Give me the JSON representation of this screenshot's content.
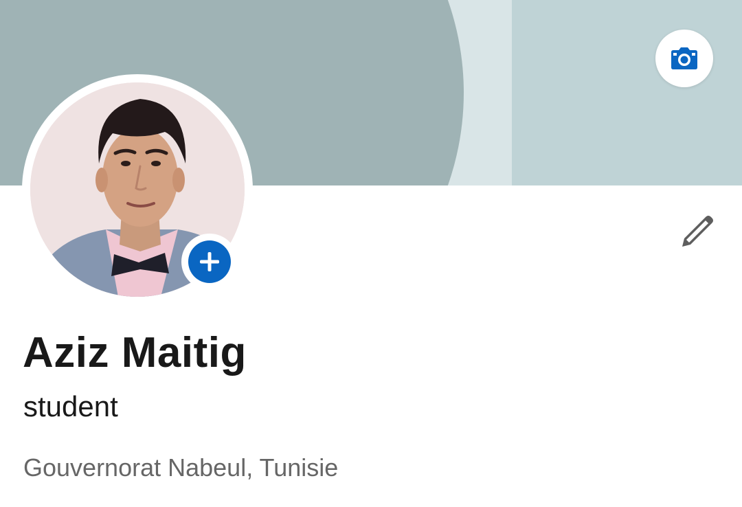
{
  "profile": {
    "name": "Aziz Maitig",
    "headline": "student",
    "location": "Gouvernorat Nabeul, Tunisie"
  },
  "icons": {
    "camera": "camera-icon",
    "add_photo": "plus-icon",
    "edit": "pencil-icon"
  },
  "colors": {
    "accent": "#0a66c2",
    "banner_dark": "#9fb3b5",
    "banner_light": "#bfd3d6",
    "text_primary": "#191919",
    "text_secondary": "#666666"
  }
}
